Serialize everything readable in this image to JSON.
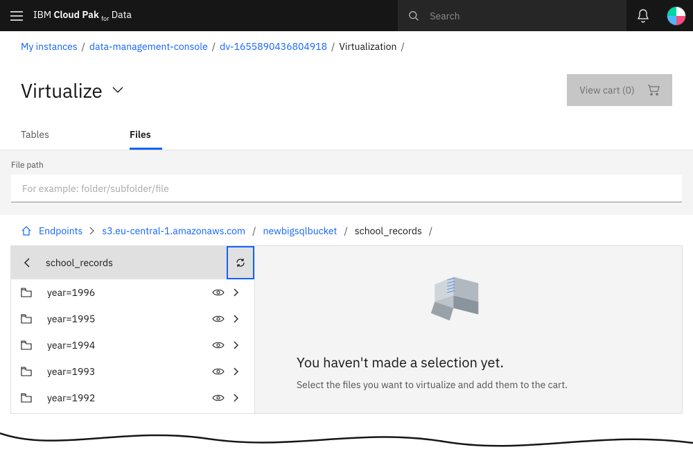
{
  "header": {
    "brand_thin": "IBM",
    "brand_bold": "Cloud Pak",
    "brand_thin2": "for",
    "brand_bold2": "Data",
    "search_placeholder": "Search"
  },
  "crumbs": {
    "items": [
      "My instances",
      "data-management-console",
      "dv-1655890436804918",
      "Virtualization"
    ],
    "active_index": 3
  },
  "page": {
    "title": "Virtualize",
    "view_cart_label": "View cart (0)"
  },
  "tabs": [
    {
      "label": "Tables",
      "active": false
    },
    {
      "label": "Files",
      "active": true
    }
  ],
  "filepath": {
    "label": "File path",
    "placeholder": "For example: folder/subfolder/file"
  },
  "pathcrumb": {
    "root": "Endpoints",
    "segments": [
      "s3.eu-central-1.amazonaws.com",
      "newbigsqlbucket",
      "school_records"
    ],
    "link_count": 2
  },
  "folder": {
    "name": "school_records",
    "rows": [
      {
        "label": "year=1996"
      },
      {
        "label": "year=1995"
      },
      {
        "label": "year=1994"
      },
      {
        "label": "year=1993"
      },
      {
        "label": "year=1992"
      }
    ]
  },
  "empty_state": {
    "title": "You haven't made a selection yet.",
    "desc": "Select the files you want to virtualize and add them to the cart."
  }
}
